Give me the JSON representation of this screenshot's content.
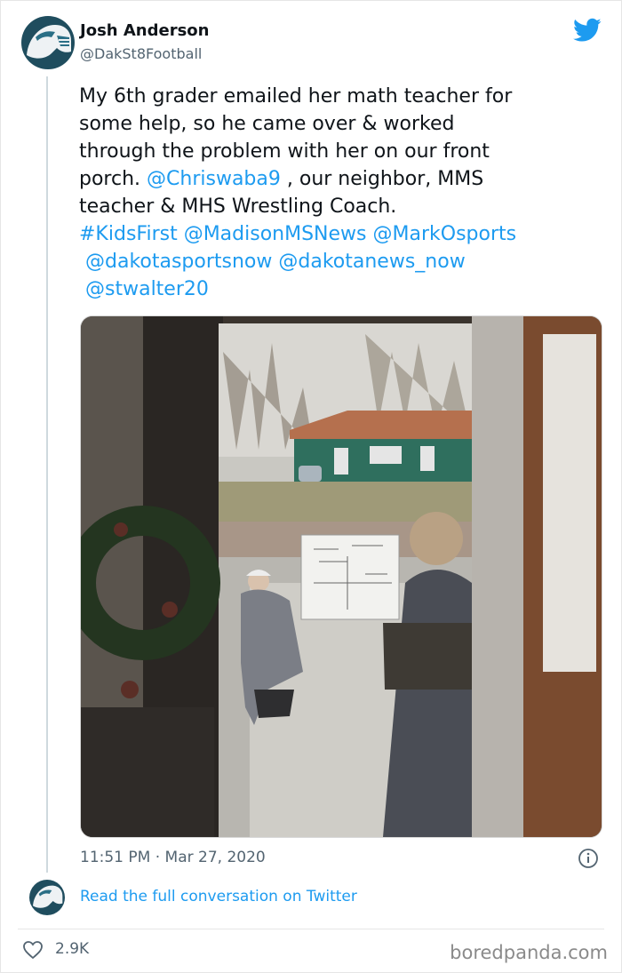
{
  "tweet": {
    "author_name": "Josh Anderson",
    "author_handle": "@DakSt8Football",
    "text_lines": [
      "My 6th grader emailed her math teacher for",
      "some help, so he came over & worked",
      "through the problem with her on our front",
      "porch."
    ],
    "mention_1": "@Chriswaba9",
    "text_after_mention": " , our neighbor, MMS",
    "text_line_6": "teacher & MHS Wrestling Coach.",
    "hashtag": "#KidsFirst",
    "mention_2": "@MadisonMSNews",
    "mention_3": "@MarkOsports",
    "mention_4": "@dakotasportsnow",
    "mention_5": "@dakotanews_now",
    "mention_6": "@stwalter20",
    "timestamp": "11:51 PM · Mar 27, 2020",
    "read_more": "Read the full conversation on Twitter",
    "likes": "2.9K"
  },
  "icons": {
    "brand": "twitter-bird-icon",
    "info": "info-icon",
    "like": "heart-icon"
  },
  "colors": {
    "accent": "#1d9bf0",
    "muted": "#536471"
  },
  "watermark": "boredpanda.com"
}
